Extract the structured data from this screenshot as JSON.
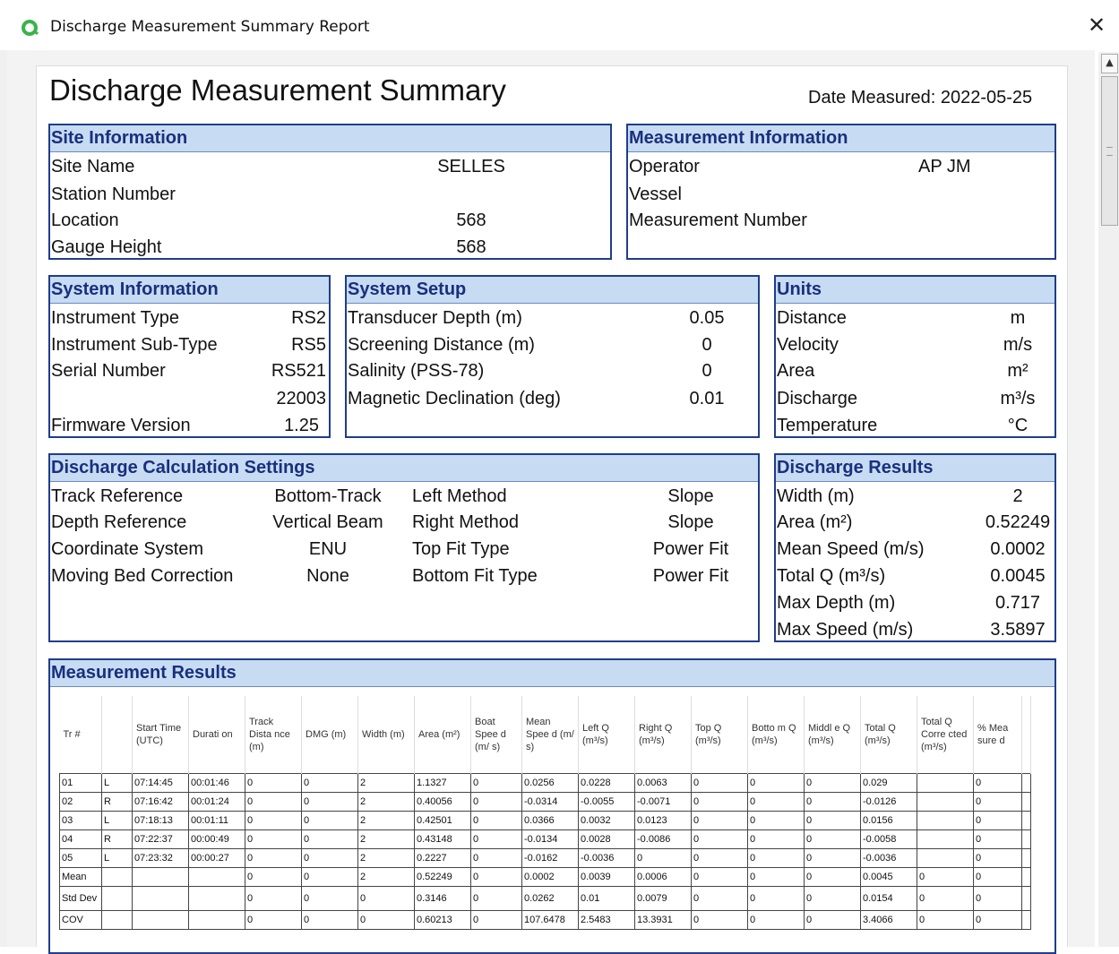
{
  "window": {
    "title": "Discharge Measurement Summary Report",
    "close_glyph": "✕"
  },
  "report": {
    "title": "Discharge Measurement Summary",
    "date_measured": "Date Measured: 2022-05-25"
  },
  "site": {
    "header": "Site Information",
    "rows": [
      {
        "label": "Site Name",
        "value": "SELLES"
      },
      {
        "label": "Station Number",
        "value": ""
      },
      {
        "label": "Location",
        "value": "568"
      },
      {
        "label": "Gauge Height",
        "value": "568"
      }
    ]
  },
  "measurement": {
    "header": "Measurement Information",
    "rows": [
      {
        "label": "Operator",
        "value": "AP  JM"
      },
      {
        "label": "Vessel",
        "value": ""
      },
      {
        "label": "Measurement Number",
        "value": ""
      }
    ]
  },
  "system_info": {
    "header": "System Information",
    "rows": [
      {
        "label": "Instrument Type",
        "value": "RS2"
      },
      {
        "label": "Instrument Sub-Type",
        "value": "RS5"
      },
      {
        "label": "Serial Number",
        "value": "RS521"
      },
      {
        "label": "",
        "value": "22003"
      },
      {
        "label": "Firmware Version",
        "value": "1.25"
      }
    ]
  },
  "system_setup": {
    "header": "System Setup",
    "rows": [
      {
        "label": "Transducer Depth (m)",
        "value": "0.05"
      },
      {
        "label": "Screening Distance (m)",
        "value": "0"
      },
      {
        "label": "Salinity (PSS-78)",
        "value": "0"
      },
      {
        "label": "Magnetic Declination (deg)",
        "value": "0.01"
      }
    ]
  },
  "units": {
    "header": "Units",
    "rows": [
      {
        "label": "Distance",
        "value": "m"
      },
      {
        "label": "Velocity",
        "value": "m/s"
      },
      {
        "label": "Area",
        "value": "m²"
      },
      {
        "label": "Discharge",
        "value": "m³/s"
      },
      {
        "label": "Temperature",
        "value": "°C"
      }
    ]
  },
  "calc_settings": {
    "header": "Discharge Calculation Settings",
    "rows": [
      {
        "label": "Track Reference",
        "value": "Bottom-Track",
        "label2": "Left Method",
        "value2": "Slope"
      },
      {
        "label": "Depth Reference",
        "value": "Vertical Beam",
        "label2": "Right Method",
        "value2": "Slope"
      },
      {
        "label": "Coordinate System",
        "value": "ENU",
        "label2": "Top Fit Type",
        "value2": "Power Fit"
      },
      {
        "label": "Moving Bed Correction",
        "value": "None",
        "label2": "Bottom Fit Type",
        "value2": "Power Fit"
      }
    ]
  },
  "results": {
    "header": "Discharge Results",
    "rows": [
      {
        "label": "Width (m)",
        "value": "2"
      },
      {
        "label": "Area (m²)",
        "value": "0.52249"
      },
      {
        "label": "Mean Speed (m/s)",
        "value": "0.0002"
      },
      {
        "label": "Total Q (m³/s)",
        "value": "0.0045"
      },
      {
        "label": "Max Depth (m)",
        "value": "0.717"
      },
      {
        "label": "Max Speed (m/s)",
        "value": "3.5897"
      }
    ]
  },
  "measurement_results": {
    "header": "Measurement Results",
    "columns": [
      "Tr #",
      "",
      "Start Time (UTC)",
      "Durati on",
      "Track Dista nce (m)",
      "DMG (m)",
      "Width (m)",
      "Area (m²)",
      "Boat Spee d (m/ s)",
      "Mean Spee d (m/ s)",
      "Left Q (m³/s)",
      "Right Q (m³/s)",
      "Top Q (m³/s)",
      "Botto m Q (m³/s)",
      "Middl e Q (m³/s)",
      "Total Q (m³/s)",
      "Total Q Corre cted (m³/s)",
      "% Mea sure d"
    ],
    "rows": [
      [
        "01",
        "L",
        "07:14:45",
        "00:01:46",
        "0",
        "0",
        "2",
        "1.1327",
        "0",
        "0.0256",
        "0.0228",
        "0.0063",
        "0",
        "0",
        "0",
        "0.029",
        "",
        "0"
      ],
      [
        "02",
        "R",
        "07:16:42",
        "00:01:24",
        "0",
        "0",
        "2",
        "0.40056",
        "0",
        "-0.0314",
        "-0.0055",
        "-0.0071",
        "0",
        "0",
        "0",
        "-0.0126",
        "",
        "0"
      ],
      [
        "03",
        "L",
        "07:18:13",
        "00:01:11",
        "0",
        "0",
        "2",
        "0.42501",
        "0",
        "0.0366",
        "0.0032",
        "0.0123",
        "0",
        "0",
        "0",
        "0.0156",
        "",
        "0"
      ],
      [
        "04",
        "R",
        "07:22:37",
        "00:00:49",
        "0",
        "0",
        "2",
        "0.43148",
        "0",
        "-0.0134",
        "0.0028",
        "-0.0086",
        "0",
        "0",
        "0",
        "-0.0058",
        "",
        "0"
      ],
      [
        "05",
        "L",
        "07:23:32",
        "00:00:27",
        "0",
        "0",
        "2",
        "0.2227",
        "0",
        "-0.0162",
        "-0.0036",
        "0",
        "0",
        "0",
        "0",
        "-0.0036",
        "",
        "0"
      ],
      [
        "Mean",
        "",
        "",
        "",
        "0",
        "0",
        "2",
        "0.52249",
        "0",
        "0.0002",
        "0.0039",
        "0.0006",
        "0",
        "0",
        "0",
        "0.0045",
        "0",
        "0"
      ],
      [
        "Std Dev",
        "",
        "",
        "",
        "0",
        "0",
        "0",
        "0.3146",
        "0",
        "0.0262",
        "0.01",
        "0.0079",
        "0",
        "0",
        "0",
        "0.0154",
        "0",
        "0"
      ],
      [
        "COV",
        "",
        "",
        "",
        "0",
        "0",
        "0",
        "0.60213",
        "0",
        "107.6478",
        "2.5483",
        "13.3931",
        "0",
        "0",
        "0",
        "3.4066",
        "0",
        "0"
      ]
    ]
  }
}
